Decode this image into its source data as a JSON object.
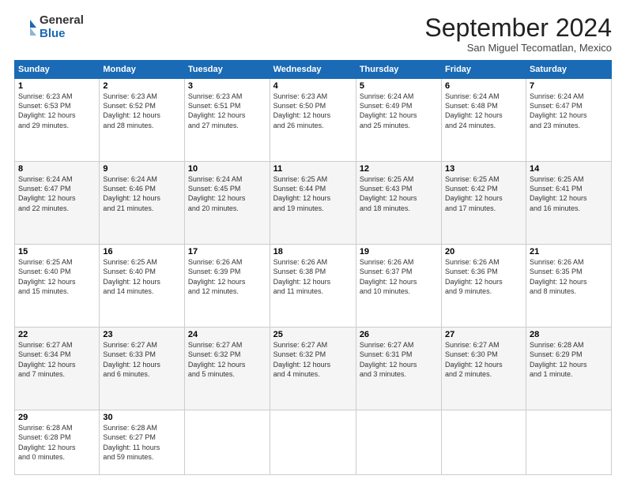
{
  "logo": {
    "general": "General",
    "blue": "Blue"
  },
  "title": "September 2024",
  "location": "San Miguel Tecomatlan, Mexico",
  "headers": [
    "Sunday",
    "Monday",
    "Tuesday",
    "Wednesday",
    "Thursday",
    "Friday",
    "Saturday"
  ],
  "weeks": [
    [
      {
        "day": "1",
        "info": "Sunrise: 6:23 AM\nSunset: 6:53 PM\nDaylight: 12 hours\nand 29 minutes."
      },
      {
        "day": "2",
        "info": "Sunrise: 6:23 AM\nSunset: 6:52 PM\nDaylight: 12 hours\nand 28 minutes."
      },
      {
        "day": "3",
        "info": "Sunrise: 6:23 AM\nSunset: 6:51 PM\nDaylight: 12 hours\nand 27 minutes."
      },
      {
        "day": "4",
        "info": "Sunrise: 6:23 AM\nSunset: 6:50 PM\nDaylight: 12 hours\nand 26 minutes."
      },
      {
        "day": "5",
        "info": "Sunrise: 6:24 AM\nSunset: 6:49 PM\nDaylight: 12 hours\nand 25 minutes."
      },
      {
        "day": "6",
        "info": "Sunrise: 6:24 AM\nSunset: 6:48 PM\nDaylight: 12 hours\nand 24 minutes."
      },
      {
        "day": "7",
        "info": "Sunrise: 6:24 AM\nSunset: 6:47 PM\nDaylight: 12 hours\nand 23 minutes."
      }
    ],
    [
      {
        "day": "8",
        "info": "Sunrise: 6:24 AM\nSunset: 6:47 PM\nDaylight: 12 hours\nand 22 minutes."
      },
      {
        "day": "9",
        "info": "Sunrise: 6:24 AM\nSunset: 6:46 PM\nDaylight: 12 hours\nand 21 minutes."
      },
      {
        "day": "10",
        "info": "Sunrise: 6:24 AM\nSunset: 6:45 PM\nDaylight: 12 hours\nand 20 minutes."
      },
      {
        "day": "11",
        "info": "Sunrise: 6:25 AM\nSunset: 6:44 PM\nDaylight: 12 hours\nand 19 minutes."
      },
      {
        "day": "12",
        "info": "Sunrise: 6:25 AM\nSunset: 6:43 PM\nDaylight: 12 hours\nand 18 minutes."
      },
      {
        "day": "13",
        "info": "Sunrise: 6:25 AM\nSunset: 6:42 PM\nDaylight: 12 hours\nand 17 minutes."
      },
      {
        "day": "14",
        "info": "Sunrise: 6:25 AM\nSunset: 6:41 PM\nDaylight: 12 hours\nand 16 minutes."
      }
    ],
    [
      {
        "day": "15",
        "info": "Sunrise: 6:25 AM\nSunset: 6:40 PM\nDaylight: 12 hours\nand 15 minutes."
      },
      {
        "day": "16",
        "info": "Sunrise: 6:25 AM\nSunset: 6:40 PM\nDaylight: 12 hours\nand 14 minutes."
      },
      {
        "day": "17",
        "info": "Sunrise: 6:26 AM\nSunset: 6:39 PM\nDaylight: 12 hours\nand 12 minutes."
      },
      {
        "day": "18",
        "info": "Sunrise: 6:26 AM\nSunset: 6:38 PM\nDaylight: 12 hours\nand 11 minutes."
      },
      {
        "day": "19",
        "info": "Sunrise: 6:26 AM\nSunset: 6:37 PM\nDaylight: 12 hours\nand 10 minutes."
      },
      {
        "day": "20",
        "info": "Sunrise: 6:26 AM\nSunset: 6:36 PM\nDaylight: 12 hours\nand 9 minutes."
      },
      {
        "day": "21",
        "info": "Sunrise: 6:26 AM\nSunset: 6:35 PM\nDaylight: 12 hours\nand 8 minutes."
      }
    ],
    [
      {
        "day": "22",
        "info": "Sunrise: 6:27 AM\nSunset: 6:34 PM\nDaylight: 12 hours\nand 7 minutes."
      },
      {
        "day": "23",
        "info": "Sunrise: 6:27 AM\nSunset: 6:33 PM\nDaylight: 12 hours\nand 6 minutes."
      },
      {
        "day": "24",
        "info": "Sunrise: 6:27 AM\nSunset: 6:32 PM\nDaylight: 12 hours\nand 5 minutes."
      },
      {
        "day": "25",
        "info": "Sunrise: 6:27 AM\nSunset: 6:32 PM\nDaylight: 12 hours\nand 4 minutes."
      },
      {
        "day": "26",
        "info": "Sunrise: 6:27 AM\nSunset: 6:31 PM\nDaylight: 12 hours\nand 3 minutes."
      },
      {
        "day": "27",
        "info": "Sunrise: 6:27 AM\nSunset: 6:30 PM\nDaylight: 12 hours\nand 2 minutes."
      },
      {
        "day": "28",
        "info": "Sunrise: 6:28 AM\nSunset: 6:29 PM\nDaylight: 12 hours\nand 1 minute."
      }
    ],
    [
      {
        "day": "29",
        "info": "Sunrise: 6:28 AM\nSunset: 6:28 PM\nDaylight: 12 hours\nand 0 minutes."
      },
      {
        "day": "30",
        "info": "Sunrise: 6:28 AM\nSunset: 6:27 PM\nDaylight: 11 hours\nand 59 minutes."
      },
      null,
      null,
      null,
      null,
      null
    ]
  ]
}
